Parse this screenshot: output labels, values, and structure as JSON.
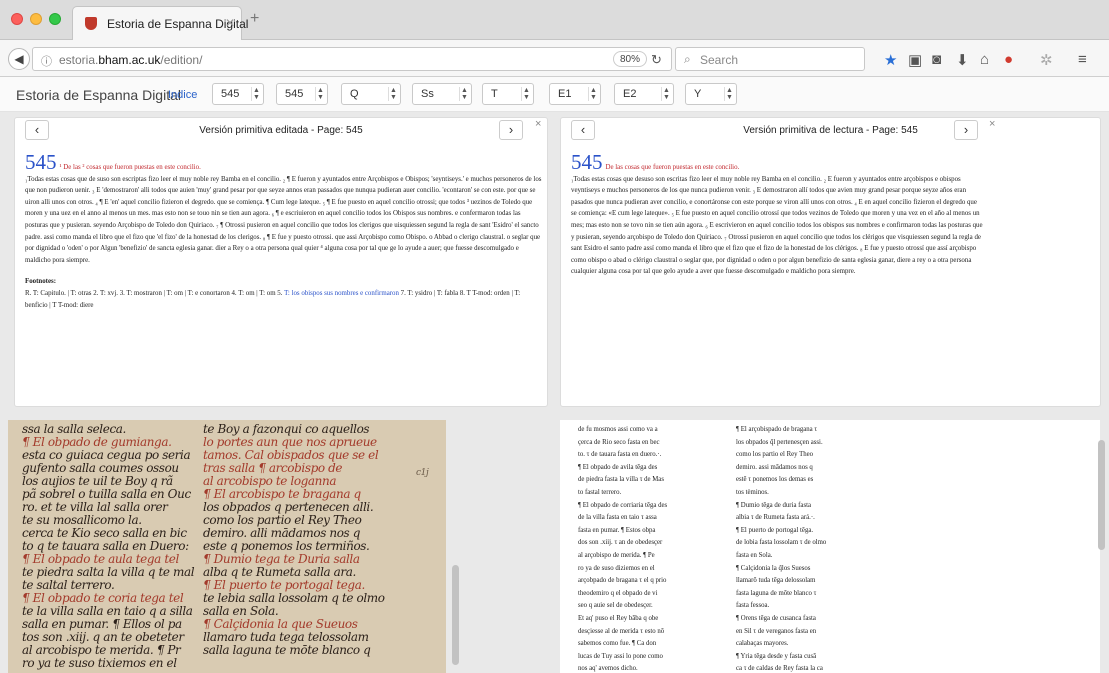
{
  "browser": {
    "tab_title": "Estoria de Espanna Digital",
    "tab_close": "✕",
    "new_tab": "+",
    "url_prefix": "estoria.",
    "url_domain": "bham.ac.uk",
    "url_path": "/edition/",
    "zoom": "80%",
    "search_placeholder": "Search"
  },
  "app": {
    "title": "Estoria de Espanna Digital",
    "indice": "Indice",
    "selects": [
      "545",
      "545",
      "Q",
      "Ss",
      "T",
      "E1",
      "E2",
      "Y"
    ]
  },
  "panel_left": {
    "title": "Versión primitiva editada - Page: 545",
    "page_num": "545",
    "heading": "¹ De las ² cosas que fueron puestas en este concilio.",
    "text": "₁Todas estas cosas que de suso son escriptas fizo leer el muy noble rey Bamba en el concilio. ₂ ¶ E fueron y ayuntados entre Arçobispos e Obispos; 'seyntiseys.' e muchos personeros de los que non pudieron uenir. ₃ E 'demostraron' alli todos que auien 'muy' grand pesar por que seyze annos eran passados que nunqua pudieran auer concilio. 'econtaron' se con este. por que se uiron alli unos con otros. ₄ ¶ E 'en' aquel concilio fizieron el degredo. que se comiença. ¶ Cum lege lateque. ₅ ¶ E fue puesto en aquel concilio otrossi; que todos ³ uezinos de Toledo que moren y una uez en el anno al menos un mes. mas esto non se touo nin se tien aun agora. ₆ ¶ e escriuieron en aquel concilio todos los Obispos sus nombres. e confermaron todas las posturas que y pusieran. seyendo Arçobispo de Toledo don Quiriaco. ₇ ¶ Otrossi pusieron en aquel concilio que todos los clerigos que uisquiessen segund la regla de sant 'Esidro' el sancto padre. assi como manda el libro que el fizo que 'el fizo' de la honestad de los clerigos. ₈ ¶ E fue y puesto otrossi. que assi Arçobispo como Obispo. o Abbad o clerigo claustral. o seglar que por dignidad o 'oden' o por Algun 'benefizio' de sancta eglesia ganar. dier a Rey o a otra persona qual quier ⁴ alguna cosa por tal que ge lo ayude a auer; que fuesse descomulgado e maldicho pora siempre.",
    "footnotes_label": "Footnotes:",
    "footnotes_a": "R. T: Capitulo. | T: otras 2. T: xvj. 3. T: mostraron | T: om | T: e conortaron 4. T: om | T: om 5. ",
    "footnotes_link": "T: los obispos sus nombres e confirmaron",
    "footnotes_b": " 7. T: ysidro | T: fabla 8. T T-mod: orden | T: benficio | T T-mod: diere"
  },
  "panel_right": {
    "title": "Versión primitiva de lectura - Page: 545",
    "page_num": "545",
    "heading": "De las cosas que fueron puestas en este concilio.",
    "text": "₁Todas estas cosas que desuso son escritas fizo leer el muy noble rey Bamba en el concilio. ₂ E fueron y ayuntados entre arçobispos e obispos veyntiseys e muchos personeros de los que nunca pudieron venir. ₃ E demostraron allí todos que avien muy grand pesar porque seyze años eran pasados que nunca pudieran aver concilio, e conortáronse con este porque se viron allí unos con otros. ₄ E en aquel concilio fizieron el degredo que se comiença: «E cum lege lateque». ₅ E fue puesto en aquel concilio otrossí que todos vezinos de Toledo que moren y una vez en el año al menos un mes; mas esto non se tovo nin se tien aún agora. ₆ E escrivieron en aquel concilio todos los obispos sus nombres e confirmaron todas las posturas que y pusieran, seyendo arçobispo de Toledo don Quiriaco. ₇ Otrossí pusieron en aquel concilio que todos los clérigos que visquiessen segund la regla de sant Esidro el santo padre assí como manda el libro que el fizo que el fizo de la honestad de los clérigos. ₈ E fue y puesto otrossí que assí arçobispo como obispo o abad o clérigo claustral o seglar que, por dignidad o oden o por algun benefizio de santa eglesia ganar, diere a rey o a otra persona cualquier alguna cosa por tal que gelo ayude a aver que fuesse descomulgado e maldicho pora siempre."
  },
  "manuscript": {
    "col1": [
      "ssa la salla seleca.",
      "¶ El obpado de gumianga.",
      "esta co guiaca cegua po seria",
      "gufento salla coumes ossou",
      "los aujios te uil te Boy q rã",
      "pã sobrel o tuilla salla en Ouc",
      "ro. et te villa lal salla orer",
      "te su mosallicomo la.",
      "cerca te Kio seco salla en bic",
      "to q te tauara salla en Duero:",
      "¶ El obpado te aula tega tel",
      "te piedra salta la villa q te mal",
      "te saltal terrero.",
      "¶ El obpado te coria tega tel",
      "te la villa salla en taio q a silla",
      "salla en pumar. ¶ Ellos ol pa",
      "tos son .xiij. q an te obeteter",
      "al arcobispo te merida. ¶ Pr",
      "ro ya te suso tixiemos en el"
    ],
    "col2": [
      "te Boy a fazonqui co aquellos",
      "lo portes aun que nos aprueue",
      "tamos. Cal obispados que se el",
      "tras salla ¶ arcobispo de",
      "al arcobispo te loganna",
      "¶ El arcobispo te bragana q",
      "los obpados q pertenecen alli.",
      "como los partio el Rey Theo",
      "demiro. alli mādamos nos q",
      "este q ponemos los termiños.",
      "¶ Dumio tega te Duria salla",
      "alba q te Rumeta salla ara.",
      "¶ El puerto te portogal tega.",
      "te lebia salla lossolam q te olmo",
      "salla en Sola.",
      "¶ Calçidonia la que Sueuos",
      "llamaro tuda tega telossolam",
      "salla laguna te mōte blanco q"
    ],
    "margin_note": "c1j"
  },
  "transcription": {
    "col1": [
      "de fu   mosmos assi como va a",
      "çerca de Rio seco fasta en bec",
      "to. τ de tauara fasta en duero.·.",
      "¶ El obpado de avila tēga des",
      "de piedra fasta la villa τ de Mas",
      "to fastal terrero.",
      "¶ El obpado de corriaria tēga des",
      "de la villa fasta en taio τ assa",
      "fasta en pumar. ¶ Estos obpa",
      "dos son .xiij. τ an de obedesçer",
      "al arçobispo de merida. ¶ Pe",
      "ro ya de suso diziemos en el",
      "arçobpado de bragana τ el q prio",
      "theodemiro q el obpado de vi",
      "seo q auie sel de obedesçer.",
      "Et aq' puso el Rey bāba q obe",
      "desçiesse al de merida τ esto nō",
      "sabemos como fue. ¶ Ca don",
      "lucas de Tuy assi lo pone como",
      "nos aq' avemos dicho."
    ],
    "col2": [
      "¶ El arçobispado de bragana τ",
      "los obpados q̃l pertenesçen assi.",
      "como los partio el Rey Theo",
      "demiro. assi mādamos nos q",
      "estē τ ponemos los demas es",
      "tos tèminos.",
      "¶ Dumio tēga de duria fasta",
      "albia τ de Rumeta fasta ará.·.",
      "¶ El puerto de portogal tēga.",
      "de lobia fasta lossolam τ de olmo",
      "fasta en Sola.",
      "¶ Calçidonia la q̃los Suesos",
      "llamarō tuda tēga delossolam",
      "fasta laguna de mōte blanco τ",
      "fasta fessoa.",
      "¶ Orens tēga de cusanca fasta",
      "en Sil τ de vereganos fasta en",
      "calabaças mayores.",
      "¶ Yria tēga desde y fasta cusā",
      "ca τ de caldas de Rey fasta la ca"
    ]
  }
}
